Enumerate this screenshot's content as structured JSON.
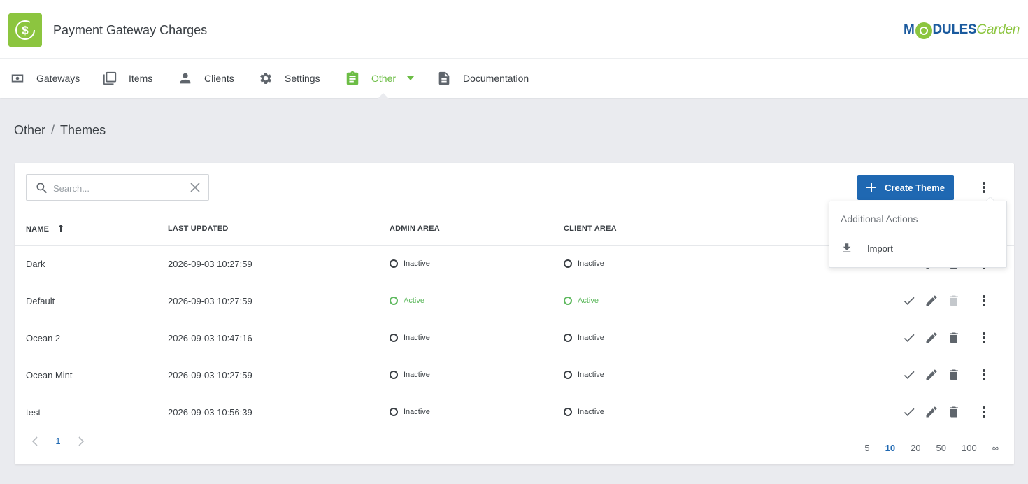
{
  "app": {
    "title": "Payment Gateway Charges"
  },
  "brand": {
    "part1": "M",
    "part2": "DULES",
    "part3": "Garden"
  },
  "nav": {
    "items": [
      {
        "label": "Gateways",
        "icon": "money-icon"
      },
      {
        "label": "Items",
        "icon": "copy-icon"
      },
      {
        "label": "Clients",
        "icon": "person-icon"
      },
      {
        "label": "Settings",
        "icon": "gear-icon"
      },
      {
        "label": "Other",
        "icon": "clipboard-icon",
        "active": true
      },
      {
        "label": "Documentation",
        "icon": "document-icon"
      }
    ]
  },
  "breadcrumb": {
    "parent": "Other",
    "separator": "/",
    "current": "Themes"
  },
  "search": {
    "placeholder": "Search...",
    "value": ""
  },
  "toolbar": {
    "create_label": "Create Theme"
  },
  "table": {
    "headers": {
      "name": "NAME",
      "updated": "LAST UPDATED",
      "admin": "ADMIN AREA",
      "client": "CLIENT AREA"
    },
    "rows": [
      {
        "name": "Dark",
        "updated": "2026-09-03 10:27:59",
        "admin": "Inactive",
        "client": "Inactive"
      },
      {
        "name": "Default",
        "updated": "2026-09-03 10:27:59",
        "admin": "Active",
        "client": "Active"
      },
      {
        "name": "Ocean 2",
        "updated": "2026-09-03 10:47:16",
        "admin": "Inactive",
        "client": "Inactive"
      },
      {
        "name": "Ocean Mint",
        "updated": "2026-09-03 10:27:59",
        "admin": "Inactive",
        "client": "Inactive"
      },
      {
        "name": "test",
        "updated": "2026-09-03 10:56:39",
        "admin": "Inactive",
        "client": "Inactive"
      }
    ]
  },
  "pagination": {
    "current_page": "1",
    "page_sizes": [
      "5",
      "10",
      "20",
      "50",
      "100",
      "∞"
    ],
    "selected_size": "10"
  },
  "dropdown": {
    "title": "Additional Actions",
    "items": [
      {
        "label": "Import",
        "icon": "download-icon"
      }
    ]
  },
  "colors": {
    "accent_green": "#8cc53f",
    "active_nav": "#6cbd45",
    "primary_blue": "#1f68b2",
    "status_active": "#5cb85c"
  }
}
